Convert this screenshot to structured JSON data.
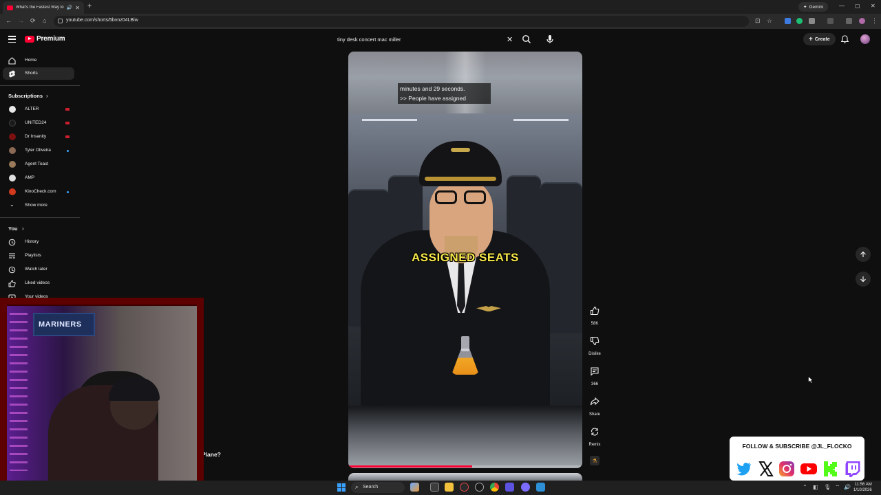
{
  "browser": {
    "tab_title": "What's the Fastest Way to",
    "url": "youtube.com/shorts/5bvnz04LBiw",
    "gemini_label": "Gemini"
  },
  "youtube": {
    "logo_text": "Premium",
    "search_query": "tiny desk concert mac miller",
    "create_label": "Create"
  },
  "sidebar": {
    "primary": [
      {
        "label": "Home",
        "icon": "home-icon"
      },
      {
        "label": "Shorts",
        "icon": "shorts-icon",
        "active": true
      }
    ],
    "subscriptions_header": "Subscriptions",
    "subscriptions": [
      {
        "label": "ALTER",
        "status": "live",
        "color": "#e8e8e8"
      },
      {
        "label": "UNITED24",
        "status": "live",
        "color": "#1a1a1a"
      },
      {
        "label": "Dr Insanity",
        "status": "live",
        "color": "#7a1010"
      },
      {
        "label": "Tyler Oliveira",
        "status": "new",
        "color": "#8a6a55"
      },
      {
        "label": "Agent Toast",
        "status": "",
        "color": "#9a7a5a"
      },
      {
        "label": "AMP",
        "status": "",
        "color": "#e0e0e0"
      },
      {
        "label": "KinoCheck.com",
        "status": "new",
        "color": "#d33a1d"
      }
    ],
    "show_more": "Show more",
    "you_header": "You",
    "you_items": [
      {
        "label": "History",
        "icon": "history-icon"
      },
      {
        "label": "Playlists",
        "icon": "playlists-icon"
      },
      {
        "label": "Watch later",
        "icon": "watch-later-icon"
      },
      {
        "label": "Liked videos",
        "icon": "liked-videos-icon"
      },
      {
        "label": "Your videos",
        "icon": "your-videos-icon"
      }
    ]
  },
  "short": {
    "caption": "minutes and 29 seconds.\n>> People have assigned",
    "overlay_text": "ASSIGNED SEATS",
    "progress": 0.53,
    "behind_title": "Plane?"
  },
  "actions": {
    "like_count": "58K",
    "dislike_label": "Dislike",
    "comment_count": "366",
    "share_label": "Share",
    "remix_label": "Remix"
  },
  "stream_overlay": {
    "follow_text": "FOLLOW & SUBSCRIBE @JL_FLOCKO",
    "banner_text": "MARINERS",
    "socials": [
      "twitter-icon",
      "x-icon",
      "instagram-icon",
      "youtube-icon",
      "kick-icon",
      "twitch-icon"
    ]
  },
  "taskbar": {
    "search_label": "Search",
    "time": "11:56 AM",
    "date": "1/10/2026"
  }
}
